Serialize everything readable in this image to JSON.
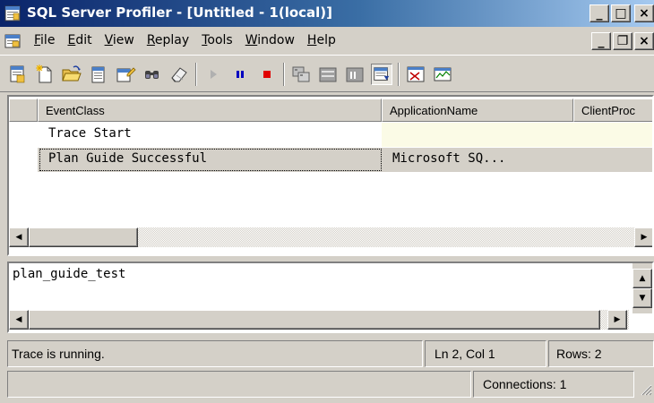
{
  "window": {
    "title": "SQL Server Profiler - [Untitled - 1(local)]"
  },
  "caption_buttons": {
    "minimize": "_",
    "maximize": "□",
    "close": "×"
  },
  "menu": {
    "items": [
      {
        "label_ul": "F",
        "label_rest": "ile"
      },
      {
        "label_ul": "E",
        "label_rest": "dit"
      },
      {
        "label_ul": "V",
        "label_rest": "iew"
      },
      {
        "label_ul": "R",
        "label_rest": "eplay"
      },
      {
        "label_ul": "T",
        "label_rest": "ools"
      },
      {
        "label_ul": "W",
        "label_rest": "indow"
      },
      {
        "label_ul": "H",
        "label_rest": "elp"
      }
    ],
    "mdi_buttons": {
      "minimize": "_",
      "restore": "❐",
      "close": "×"
    }
  },
  "toolbar": {
    "buttons": [
      {
        "icon": "properties-icon"
      },
      {
        "icon": "new-trace-icon"
      },
      {
        "icon": "open-folder-icon"
      },
      {
        "icon": "template-icon"
      },
      {
        "icon": "properties-edit-icon"
      },
      {
        "icon": "find-icon"
      },
      {
        "icon": "clear-trace-icon"
      },
      {
        "icon": "run-trace-icon"
      },
      {
        "icon": "pause-trace-icon"
      },
      {
        "icon": "stop-trace-icon"
      },
      {
        "icon": "event-selection-icon"
      },
      {
        "icon": "grouped-view-icon"
      },
      {
        "icon": "aggregated-view-icon"
      },
      {
        "icon": "auto-scroll-icon"
      },
      {
        "icon": "activity-monitor-icon"
      },
      {
        "icon": "performance-monitor-icon"
      }
    ],
    "colors": {
      "run": "#b0b0b0",
      "pause": "#0000c0",
      "stop": "#e00000"
    }
  },
  "grid": {
    "columns": [
      "EventClass",
      "ApplicationName",
      "ClientProc"
    ],
    "rows": [
      {
        "EventClass": "Trace Start",
        "ApplicationName": ""
      },
      {
        "EventClass": "Plan Guide Successful",
        "ApplicationName": "Microsoft SQ..."
      }
    ]
  },
  "text_panel": {
    "content": "plan_guide_test"
  },
  "status": {
    "message": "Trace is running.",
    "position": "Ln 2, Col 1",
    "rows": "Rows: 2",
    "connections": "Connections: 1"
  }
}
